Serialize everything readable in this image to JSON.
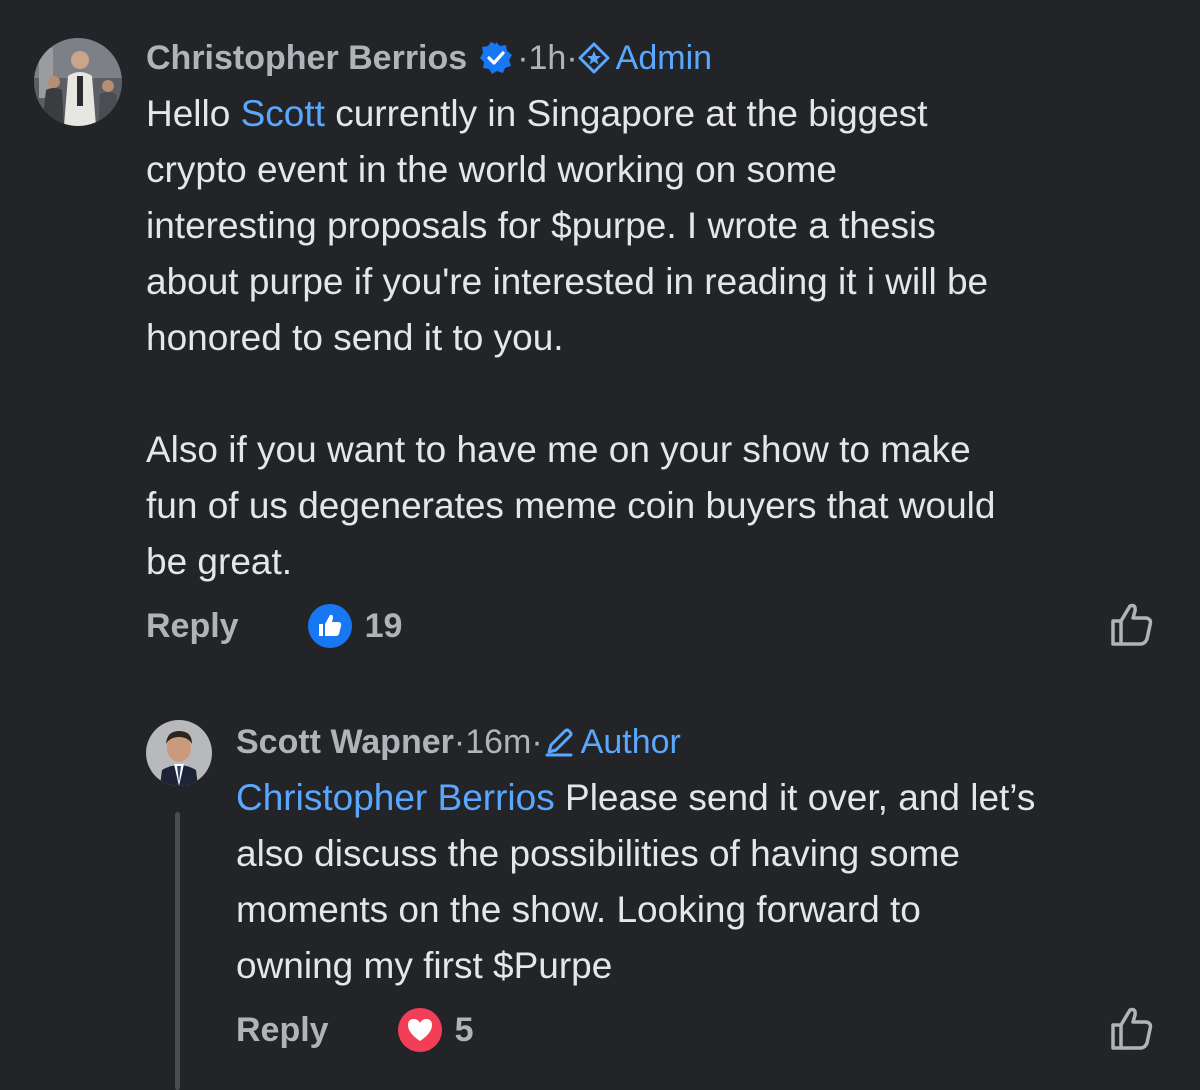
{
  "comments": [
    {
      "author": "Christopher Berrios",
      "verified": true,
      "time": "1h",
      "role": "Admin",
      "mention": "Hello",
      "mention_name": "Scott",
      "text_after_mention": " currently in Singapore at the biggest\ncrypto event in the world working on some\ninteresting proposals for $purpe. I wrote a thesis\nabout purpe if you're interested in reading it i will be\nhonored to send it to you.\n\nAlso if you want to have me on your show to make\nfun of us degenerates meme coin buyers that would\nbe great.",
      "reply_label": "Reply",
      "reaction_type": "like",
      "reaction_count": "19"
    },
    {
      "author": "Scott Wapner",
      "verified": false,
      "time": "16m",
      "role": "Author",
      "mention_name": "Christopher Berrios",
      "text_after_mention": " Please send it over, and let’s\nalso discuss the possibilities of having some\nmoments on the show. Looking forward to\nowning my first $Purpe",
      "reply_label": "Reply",
      "reaction_type": "love",
      "reaction_count": "5"
    }
  ],
  "icons": {
    "verified": "verified-badge-icon",
    "admin": "admin-star-icon",
    "author": "pencil-icon",
    "like_reaction": "thumbs-up-reaction-icon",
    "love_reaction": "heart-reaction-icon",
    "like_button": "thumbs-up-outline-icon"
  },
  "colors": {
    "background": "#232427",
    "text": "#e4e6eb",
    "secondary": "#b0b3b8",
    "link": "#5aa7ff",
    "like_blue": "#1877f2",
    "love_red": "#f33e58"
  },
  "separator": " · "
}
